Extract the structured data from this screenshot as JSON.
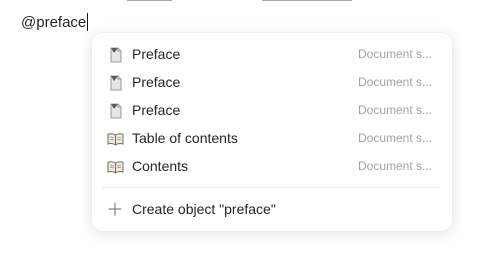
{
  "editor": {
    "typed_text": "@preface"
  },
  "mention_menu": {
    "items": [
      {
        "label": "Preface",
        "type": "Document s...",
        "icon": "page-icon"
      },
      {
        "label": "Preface",
        "type": "Document s...",
        "icon": "page-icon"
      },
      {
        "label": "Preface",
        "type": "Document s...",
        "icon": "page-icon"
      },
      {
        "label": "Table of contents",
        "type": "Document s...",
        "icon": "book-icon"
      },
      {
        "label": "Contents",
        "type": "Document s...",
        "icon": "book-icon"
      }
    ],
    "create_label": "Create object \"preface\"",
    "create_icon": "plus-icon"
  }
}
